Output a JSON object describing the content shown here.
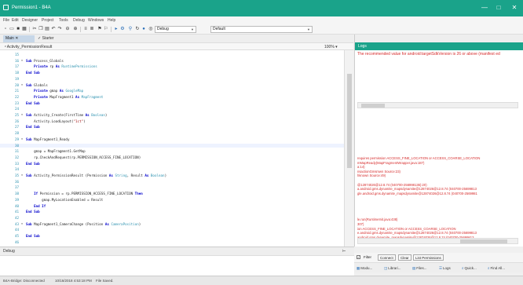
{
  "window": {
    "title": "Permission1 - B4A",
    "minimize": "—",
    "maximize": "□",
    "close": "✕"
  },
  "menu": [
    "File",
    "Edit",
    "Designer",
    "Project",
    "Tools",
    "Debug",
    "Windows",
    "Help"
  ],
  "toolbar": {
    "mode": "Debug",
    "config": "Default"
  },
  "tabs": {
    "main": "Main",
    "starter": "Starter"
  },
  "editor": {
    "sub_selector": "Activity_PermissionResult",
    "zoom": "100%",
    "lines": [
      {
        "n": "15",
        "f": "",
        "parts": []
      },
      {
        "n": "16",
        "f": "⊟",
        "parts": [
          {
            "c": "k",
            "t": "Sub "
          },
          {
            "c": "n",
            "t": "Process_Globals"
          }
        ]
      },
      {
        "n": "17",
        "f": "",
        "parts": [
          {
            "c": "k",
            "t": "    Private "
          },
          {
            "c": "n",
            "t": "rp "
          },
          {
            "c": "k",
            "t": "As "
          },
          {
            "c": "t",
            "t": "RuntimePermissions"
          }
        ]
      },
      {
        "n": "18",
        "f": "",
        "parts": [
          {
            "c": "k",
            "t": "End Sub"
          }
        ]
      },
      {
        "n": "19",
        "f": "",
        "parts": []
      },
      {
        "n": "20",
        "f": "⊟",
        "parts": [
          {
            "c": "k",
            "t": "Sub "
          },
          {
            "c": "n",
            "t": "Globals"
          }
        ]
      },
      {
        "n": "21",
        "f": "",
        "parts": [
          {
            "c": "k",
            "t": "    Private "
          },
          {
            "c": "n",
            "t": "gmap "
          },
          {
            "c": "k",
            "t": "As "
          },
          {
            "c": "t",
            "t": "GoogleMap"
          }
        ]
      },
      {
        "n": "22",
        "f": "",
        "parts": [
          {
            "c": "k",
            "t": "    Private "
          },
          {
            "c": "n",
            "t": "MapFragment1 "
          },
          {
            "c": "k",
            "t": "As "
          },
          {
            "c": "t",
            "t": "MapFragment"
          }
        ]
      },
      {
        "n": "23",
        "f": "",
        "parts": [
          {
            "c": "k",
            "t": "End Sub"
          }
        ]
      },
      {
        "n": "24",
        "f": "",
        "parts": []
      },
      {
        "n": "25",
        "f": "⊟",
        "parts": [
          {
            "c": "k",
            "t": "Sub "
          },
          {
            "c": "n",
            "t": "Activity_Create(FirstTime "
          },
          {
            "c": "k",
            "t": "As "
          },
          {
            "c": "t",
            "t": "Boolean"
          },
          {
            "c": "n",
            "t": ")"
          }
        ]
      },
      {
        "n": "26",
        "f": "",
        "parts": [
          {
            "c": "n",
            "t": "    Activity.LoadLayout("
          },
          {
            "c": "s",
            "t": "\"1ct\""
          },
          {
            "c": "n",
            "t": ")"
          }
        ]
      },
      {
        "n": "27",
        "f": "",
        "parts": [
          {
            "c": "k",
            "t": "End Sub"
          }
        ]
      },
      {
        "n": "28",
        "f": "",
        "parts": []
      },
      {
        "n": "29",
        "f": "⊟",
        "parts": [
          {
            "c": "k",
            "t": "Sub "
          },
          {
            "c": "n",
            "t": "MapFragment1_Ready"
          }
        ]
      },
      {
        "n": "30",
        "f": "",
        "parts": []
      },
      {
        "n": "31",
        "f": "",
        "parts": [
          {
            "c": "n",
            "t": "    gmap = MapFragment1.GetMap"
          }
        ]
      },
      {
        "n": "32",
        "f": "",
        "parts": [
          {
            "c": "n",
            "t": "    rp.CheckAndRequest(rp.PERMISSION_ACCESS_FINE_LOCATION)"
          }
        ]
      },
      {
        "n": "33",
        "f": "",
        "parts": [
          {
            "c": "k",
            "t": "End Sub"
          }
        ]
      },
      {
        "n": "34",
        "f": "",
        "parts": []
      },
      {
        "n": "35",
        "f": "⊟",
        "parts": [
          {
            "c": "k",
            "t": "Sub "
          },
          {
            "c": "n",
            "t": "Activity_PermissionResult (Permission "
          },
          {
            "c": "k",
            "t": "As "
          },
          {
            "c": "t",
            "t": "String"
          },
          {
            "c": "n",
            "t": ", Result "
          },
          {
            "c": "k",
            "t": "As "
          },
          {
            "c": "t",
            "t": "Boolean"
          },
          {
            "c": "n",
            "t": ")"
          }
        ]
      },
      {
        "n": "36",
        "f": "",
        "parts": []
      },
      {
        "n": "37",
        "f": "",
        "parts": []
      },
      {
        "n": "38",
        "f": "",
        "parts": [
          {
            "c": "k",
            "t": "    If "
          },
          {
            "c": "n",
            "t": "Permission = rp.PERMISSION_ACCESS_FINE_LOCATION "
          },
          {
            "c": "k",
            "t": "Then"
          }
        ]
      },
      {
        "n": "39",
        "f": "",
        "parts": [
          {
            "c": "n",
            "t": "        gmap.MyLocationEnabled = Result"
          }
        ]
      },
      {
        "n": "40",
        "f": "",
        "parts": [
          {
            "c": "k",
            "t": "    End If"
          }
        ]
      },
      {
        "n": "41",
        "f": "",
        "parts": [
          {
            "c": "k",
            "t": "End Sub"
          }
        ]
      },
      {
        "n": "42",
        "f": "",
        "parts": []
      },
      {
        "n": "43",
        "f": "⊟",
        "parts": [
          {
            "c": "k",
            "t": "Sub "
          },
          {
            "c": "n",
            "t": "MapFragment1_CameraChange (Position "
          },
          {
            "c": "k",
            "t": "As "
          },
          {
            "c": "t",
            "t": "CameraPosition"
          },
          {
            "c": "n",
            "t": ")"
          }
        ]
      },
      {
        "n": "44",
        "f": "",
        "parts": []
      },
      {
        "n": "45",
        "f": "",
        "parts": [
          {
            "c": "k",
            "t": "End Sub"
          }
        ]
      },
      {
        "n": "46",
        "f": "",
        "parts": []
      }
    ]
  },
  "logs": {
    "tab": "Logs",
    "warning": "The recommended value for android:targetSdkVersion is 26 or above (manifest ed",
    "lines": [
      "requires permission ACCESS_FINE_LOCATION or ACCESS_COARSE_LOCATION",
      "mMapReady(MapFragmentWrapper.java:187)",
      "a:14)",
      "nsactionGmsmwn Source:23)",
      "hknown Source:49)",
      "",
      "@12874026@12.8.74 (040700-256998136):20)",
      "a.android.gms.dynamite_mapsdynamite@12874026@12.8.74 (040700-25699813",
      "gle.android.gms.dynamite_mapsdynamite@12874026@12.8.74 (040700-2569981",
      "",
      "",
      "",
      "",
      "",
      "le.run(RuntimeInit.java:438)",
      "307)",
      "ion ACCESS_FINE_LOCATION or ACCESS_COARSE_LOCATION",
      "e.android.gms.dynamite_mapsdynamite@12874026@12.8.74 (040700-25699813",
      "android.gms.dynamite_mapsdynamite@12874026@12.8.74 (040700-25699813"
    ],
    "controls": {
      "filter": "Filter",
      "connect": "Connect",
      "clear": "Clear",
      "list_permissions": "List Permissions"
    },
    "bottom_tabs": [
      "Modu...",
      "Librari...",
      "Files...",
      "Logs",
      "Quick...",
      "Find All..."
    ]
  },
  "debug": {
    "title": "Debug"
  },
  "status": {
    "bridge": "B4A-Bridge: Disconnected",
    "timestamp": "10/16/2018 4:53:18 PM",
    "saved": "File Saved."
  }
}
